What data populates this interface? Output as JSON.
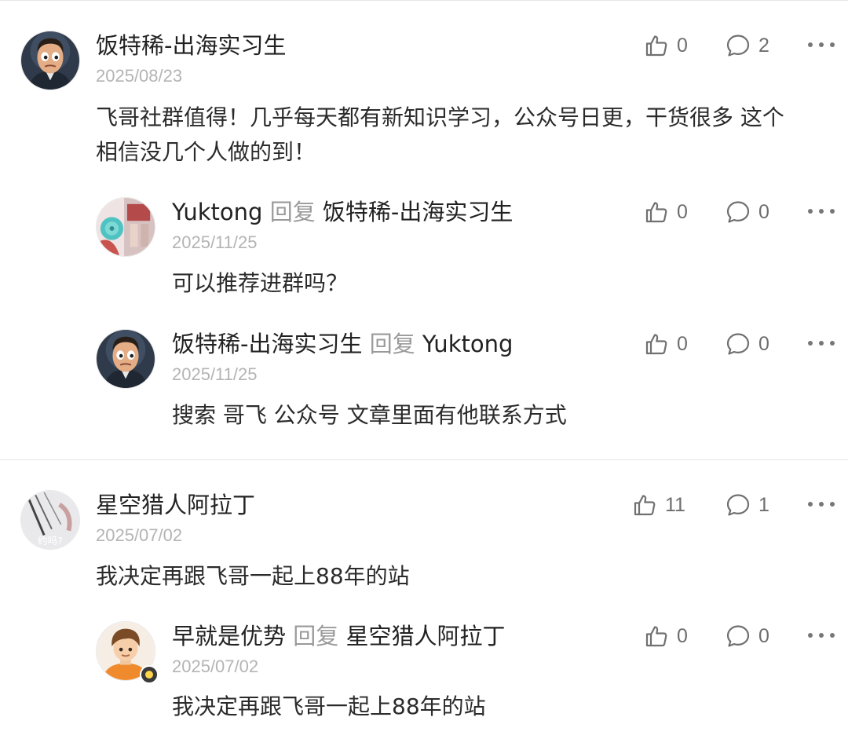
{
  "reply_word": "回复",
  "threads": [
    {
      "comment": {
        "author": "饭特稀-出海实习生",
        "date": "2025/08/23",
        "text_line1": "飞哥社群值得！几乎每天都有新知识学习，公众号日更，干货很多 这个",
        "text_line2": "相信没几个人做的到！",
        "likes": "0",
        "replies": "2",
        "avatar_icon": "cartoon-man-avatar"
      },
      "replies": [
        {
          "author": "Yuktong",
          "reply_to": "饭特稀-出海实习生",
          "date": "2025/11/25",
          "text": "可以推荐进群吗？",
          "likes": "0",
          "replies": "0",
          "avatar_icon": "photo-avatar"
        },
        {
          "author": "饭特稀-出海实习生",
          "reply_to": "Yuktong",
          "date": "2025/11/25",
          "text": "搜索 哥飞 公众号 文章里面有他联系方式",
          "likes": "0",
          "replies": "0",
          "avatar_icon": "cartoon-man-avatar"
        }
      ]
    },
    {
      "comment": {
        "author": "星空猎人阿拉丁",
        "date": "2025/07/02",
        "text": "我决定再跟飞哥一起上88年的站",
        "likes": "11",
        "replies": "1",
        "avatar_icon": "sketch-avatar",
        "avatar_text": "约吗?"
      },
      "replies": [
        {
          "author": "早就是优势",
          "reply_to": "星空猎人阿拉丁",
          "date": "2025/07/02",
          "text": "我决定再跟飞哥一起上88年的站",
          "likes": "0",
          "replies": "0",
          "avatar_icon": "cartoon-boy-avatar"
        }
      ]
    }
  ],
  "colors": {
    "text": "#222222",
    "muted": "#9a9a9a",
    "date": "#b4b4b4",
    "separator": "#e6e6e6"
  }
}
